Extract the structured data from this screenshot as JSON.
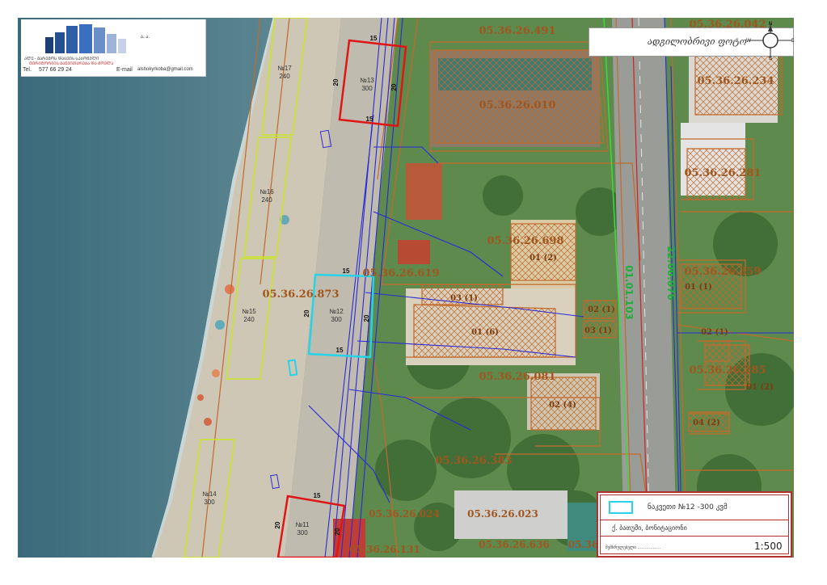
{
  "company": {
    "line1": "ᲐᲚᲔ - ᲒᲐᲠᲔᲛᲝᲡ ᲓᲐᲪᲕᲘᲡ ᲡᲐᲑᲝᲜᲔᲚᲘ",
    "line2": "ᲢᲔᲠᲘᲢᲝᲠᲘᲘᲡ ᲒᲐᲜᲕᲘᲗᲐᲠᲔᲑᲐ ᲓᲐ ᲛᲝᲕᲚᲐ",
    "logo_mark": "ა. ა.",
    "phone_label": "Tel.",
    "phone": "577 66 29 24",
    "email_label": "E-mail",
    "email": "alshokyrkoba@gmail.com"
  },
  "compass": {
    "caption": "ადგილობრივი ფოტო",
    "north": "N",
    "south": "S",
    "east": "E",
    "west": "W"
  },
  "parcels": [
    "05.36.26.491",
    "05.36.26.042",
    "05.36.26.234",
    "05.36.26.010",
    "05.36.26.281",
    "05.36.26.698",
    "05.36.26.619",
    "05.36.26.873",
    "05.36.26.359",
    "05.36.26.285",
    "05.36.26.081",
    "05.36.26.383",
    "05.36.26.024",
    "05.36.26.023",
    "05.36.26.131",
    "05.36.26.636",
    "05.36.26"
  ],
  "sub_parcels": [
    "01 (2)",
    "03 (1)",
    "01 (6)",
    "02 (1)",
    "03 (1)",
    "01 (1)",
    "02 (1)",
    "01 (2)",
    "02 (4)",
    "04 (2)"
  ],
  "zones": [
    "01.01.103",
    "22.00.076"
  ],
  "lots": [
    {
      "id": "№17",
      "area": "240"
    },
    {
      "id": "№13",
      "area": "300"
    },
    {
      "id": "№16",
      "area": "240"
    },
    {
      "id": "№12",
      "area": "300"
    },
    {
      "id": "№15",
      "area": "240"
    },
    {
      "id": "№14",
      "area": "300"
    },
    {
      "id": "№11",
      "area": "300"
    }
  ],
  "dims": {
    "width": "15",
    "depth": "20"
  },
  "legend": {
    "item_label": "ნაკვეთი №12 -300 კვმ",
    "subtitle": "ქ. ბათუმი, ბონიტაციონი",
    "sign_label": "შემსრულებელი ..................",
    "scale": "1:500"
  },
  "colors": {
    "sea": "#3f6f80",
    "beach": "#d2c9b9",
    "highlight": "#27d3e8",
    "lot_red": "#e01515",
    "lot_yellow": "#c8e626",
    "cadastral": "#c26a2c",
    "utility": "#2a2ad8"
  }
}
